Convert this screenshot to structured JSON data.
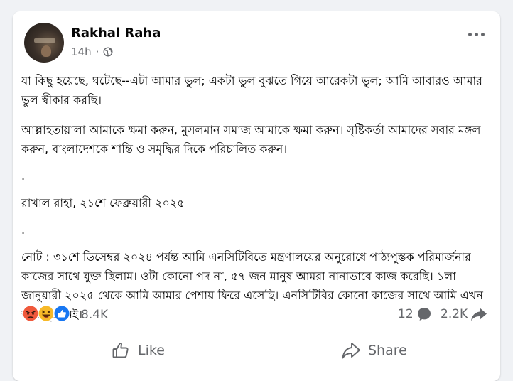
{
  "post": {
    "author": "Rakhal Raha",
    "time": "14h",
    "privacy_icon": "globe-icon",
    "paragraphs": [
      "যা কিছু হয়েছে, ঘটেছে--এটা আমার ভুল; একটা ভুল বুঝতে গিয়ে আরেকটা ভুল; আমি আবারও আমার ভুল স্বীকার করছি।",
      "আল্লাহতায়ালা আমাকে ক্ষমা করুন, মুসলমান সমাজ আমাকে ক্ষমা করুন। সৃষ্টিকর্তা আমাদের সবার মঙ্গল করুন, বাংলাদেশকে শান্তি ও সমৃদ্ধির দিকে পরিচালিত করুন।",
      ".",
      "রাখাল রাহা, ২১শে ফেব্রুয়ারী ২০২৫",
      ".",
      "নোট : ৩১শে ডিসেম্বর ২০২৪ পর্যন্ত আমি এনসিটিবিতে মন্ত্রণালয়ের অনুরোধে পাঠ্যপুস্তক পরিমার্জনার কাজের সাথে যুক্ত ছিলাম। ওটা কোনো পদ না, ৫৭ জন মানুষ আমরা নানাভাবে কাজ করেছি। ১লা জানুয়ারী ২০২৫ থেকে আমি আমার পেশায় ফিরে এসেছি। এনসিটিবির কোনো কাজের সাথে আমি এখন আর যুক্ত নই।"
    ]
  },
  "stats": {
    "reaction_icons": [
      "angry-icon",
      "haha-icon",
      "like-reaction-icon"
    ],
    "reactions": "8.4K",
    "comments": "12",
    "shares": "2.2K"
  },
  "actions": {
    "like": "Like",
    "share": "Share"
  },
  "colors": {
    "background": "#f0f2f5",
    "card": "#ffffff",
    "text": "#050505",
    "secondary_text": "#65676b",
    "like_blue": "#1877f2"
  }
}
